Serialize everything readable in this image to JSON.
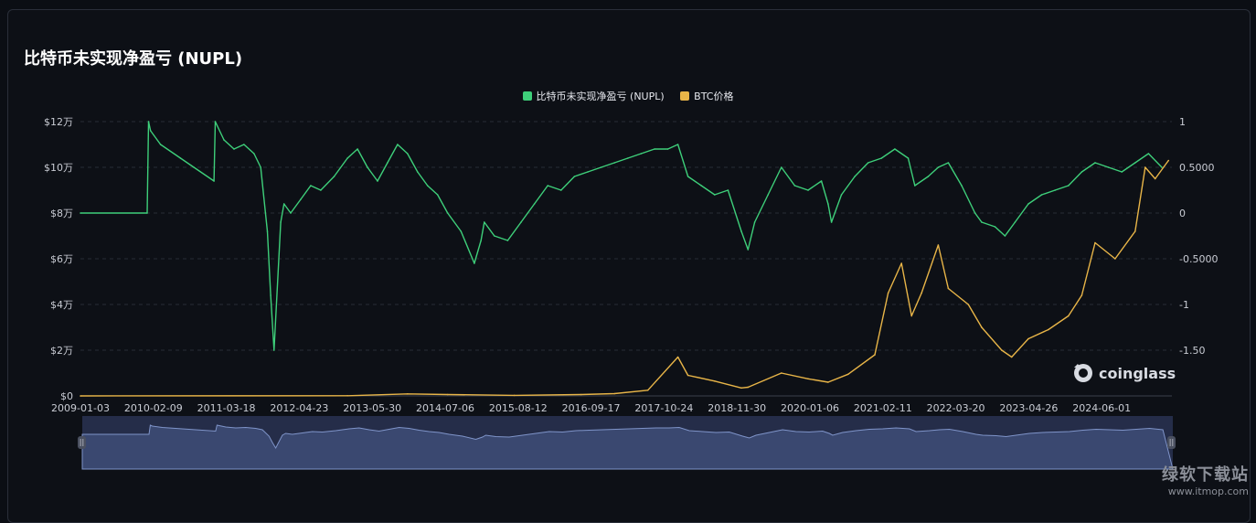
{
  "title": "比特币未实现净盈亏 (NUPL)",
  "legend": [
    {
      "label": "比特币未实现净盈亏 (NUPL)",
      "color": "#3ecf7a"
    },
    {
      "label": "BTC价格",
      "color": "#e8b548"
    }
  ],
  "logo_text": "coinglass",
  "watermark": {
    "main": "绿软下载站",
    "sub": "www.itmop.com"
  },
  "chart_data": {
    "type": "line",
    "x_tick_labels": [
      "2009-01-03",
      "2010-02-09",
      "2011-03-18",
      "2012-04-23",
      "2013-05-30",
      "2014-07-06",
      "2015-08-12",
      "2016-09-17",
      "2017-10-24",
      "2018-11-30",
      "2020-01-06",
      "2021-02-11",
      "2022-03-20",
      "2023-04-26",
      "2024-06-01"
    ],
    "y_left_tick_labels": [
      "$12万",
      "$10万",
      "$8万",
      "$6万",
      "$4万",
      "$2万",
      "$0"
    ],
    "y_right_tick_labels": [
      "1",
      "0.5000",
      "0",
      "-0.5000",
      "-1",
      "-1.50"
    ],
    "y_left_range": [
      0,
      120000
    ],
    "y_right_range": [
      -2,
      1
    ],
    "series": [
      {
        "name": "比特币未实现净盈亏 (NUPL)",
        "color": "#3ecf7a",
        "axis": "right",
        "x": [
          2009.0,
          2010.0,
          2010.02,
          2010.05,
          2010.2,
          2010.5,
          2010.7,
          2011.0,
          2011.02,
          2011.15,
          2011.3,
          2011.45,
          2011.6,
          2011.7,
          2011.8,
          2011.85,
          2011.9,
          2012.0,
          2012.05,
          2012.15,
          2012.3,
          2012.45,
          2012.6,
          2012.8,
          2013.0,
          2013.15,
          2013.3,
          2013.45,
          2013.6,
          2013.75,
          2013.9,
          2014.05,
          2014.2,
          2014.35,
          2014.5,
          2014.7,
          2014.9,
          2015.0,
          2015.05,
          2015.2,
          2015.4,
          2015.6,
          2015.8,
          2016.0,
          2016.2,
          2016.4,
          2016.6,
          2016.8,
          2017.0,
          2017.2,
          2017.4,
          2017.6,
          2017.8,
          2017.95,
          2018.1,
          2018.3,
          2018.5,
          2018.7,
          2018.9,
          2019.0,
          2019.1,
          2019.3,
          2019.5,
          2019.7,
          2019.9,
          2020.1,
          2020.2,
          2020.25,
          2020.4,
          2020.6,
          2020.8,
          2021.0,
          2021.2,
          2021.4,
          2021.5,
          2021.7,
          2021.85,
          2022.0,
          2022.2,
          2022.4,
          2022.5,
          2022.7,
          2022.85,
          2023.0,
          2023.2,
          2023.4,
          2023.6,
          2023.8,
          2024.0,
          2024.2,
          2024.4,
          2024.6,
          2024.8,
          2025.0,
          2025.2
        ],
        "y": [
          0,
          0,
          1.0,
          0.9,
          0.75,
          0.6,
          0.5,
          0.35,
          1.0,
          0.8,
          0.7,
          0.75,
          0.65,
          0.5,
          -0.2,
          -0.9,
          -1.5,
          -0.1,
          0.1,
          0.0,
          0.15,
          0.3,
          0.25,
          0.4,
          0.6,
          0.7,
          0.5,
          0.35,
          0.55,
          0.75,
          0.65,
          0.45,
          0.3,
          0.2,
          0.0,
          -0.2,
          -0.55,
          -0.3,
          -0.1,
          -0.25,
          -0.3,
          -0.1,
          0.1,
          0.3,
          0.25,
          0.4,
          0.45,
          0.5,
          0.55,
          0.6,
          0.65,
          0.7,
          0.7,
          0.75,
          0.4,
          0.3,
          0.2,
          0.25,
          -0.2,
          -0.4,
          -0.1,
          0.2,
          0.5,
          0.3,
          0.25,
          0.35,
          0.1,
          -0.1,
          0.2,
          0.4,
          0.55,
          0.6,
          0.7,
          0.6,
          0.3,
          0.4,
          0.5,
          0.55,
          0.3,
          0.0,
          -0.1,
          -0.15,
          -0.25,
          -0.1,
          0.1,
          0.2,
          0.25,
          0.3,
          0.45,
          0.55,
          0.5,
          0.45,
          0.55,
          0.65,
          0.5
        ]
      },
      {
        "name": "BTC价格",
        "color": "#e8b548",
        "axis": "left",
        "x": [
          2009.0,
          2013.0,
          2013.9,
          2014.5,
          2015.5,
          2016.5,
          2017.0,
          2017.5,
          2017.95,
          2018.1,
          2018.5,
          2018.9,
          2019.0,
          2019.5,
          2019.9,
          2020.2,
          2020.5,
          2020.9,
          2021.1,
          2021.3,
          2021.45,
          2021.6,
          2021.85,
          2022.0,
          2022.3,
          2022.5,
          2022.8,
          2022.95,
          2023.2,
          2023.5,
          2023.8,
          2024.0,
          2024.2,
          2024.5,
          2024.8,
          2024.95,
          2025.1,
          2025.3
        ],
        "y": [
          0,
          100,
          900,
          600,
          250,
          600,
          1000,
          2500,
          17000,
          9000,
          6500,
          3500,
          3800,
          10000,
          7500,
          6000,
          9500,
          18000,
          45000,
          58000,
          35000,
          45000,
          66000,
          47000,
          40000,
          30000,
          20000,
          17000,
          25000,
          29000,
          35000,
          44000,
          67000,
          60000,
          72000,
          100000,
          95000,
          103000
        ]
      }
    ]
  }
}
